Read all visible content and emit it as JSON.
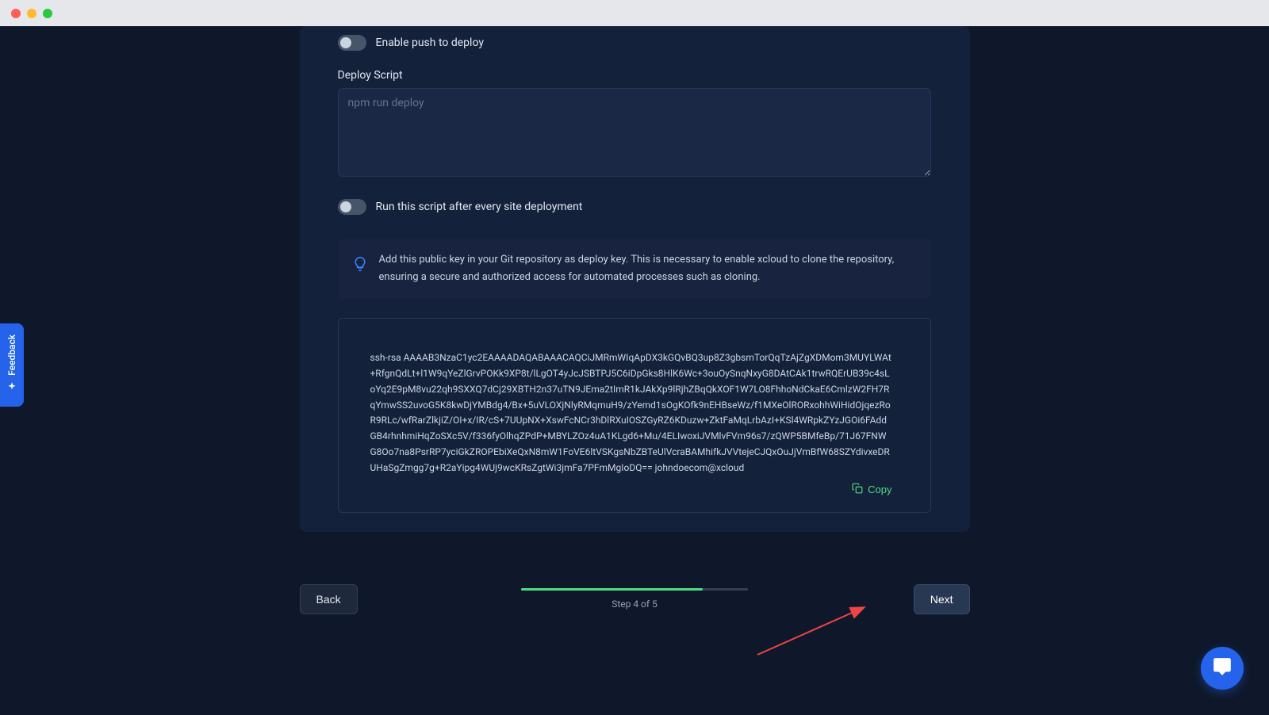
{
  "toggles": {
    "push_deploy": {
      "label": "Enable push to deploy",
      "enabled": false
    },
    "run_after": {
      "label": "Run this script after every site deployment",
      "enabled": false
    }
  },
  "deploy_script": {
    "label": "Deploy Script",
    "placeholder": "npm run deploy",
    "value": ""
  },
  "info": {
    "text": "Add this public key in your Git repository as deploy key. This is necessary to enable xcloud to clone the repository, ensuring a secure and authorized access for automated processes such as cloning."
  },
  "ssh_key": {
    "text": "ssh-rsa AAAAB3NzaC1yc2EAAAADAQABAAACAQCiJMRmWIqApDX3kGQvBQ3up8Z3gbsmTorQqTzAjZgXDMom3MUYLWAt+RfgnQdLt+l1W9qYeZlGrvPOKk9XP8t/lLgOT4yJcJSBTPJ5C6iDpGks8HlK6Wc+3ouOySnqNxyG8DAtCAk1trwRQErUB39c4sLoYq2E9pM8vu22qh9SXXQ7dCj29XBTH2n37uTN9JEma2tImR1kJAkXp9lRjhZBqQkXOF1W7LO8FhhoNdCkaE6CmlzW2FH7RqYmwSS2uvoG5K8kwDjYMBdg4/Bx+5uVLOXjNlyRMqmuH9/zYemd1sOgKOfk9nEHBseWz/f1MXeOlRORxohhWiHidOjqezRoR9RLc/wfRarZlkjiZ/OI+x/IR/cS+7UUpNX+XswFcNCr3hDlRXuIOSZGyRZ6KDuzw+ZktFaMqLrbAzI+KSl4WRpkZYzJGOi6FAddGB4rhnhmiHqZoSXc5V/f336fyOlhqZPdP+MBYLZOz4uA1KLgd6+Mu/4ELIwoxiJVMlvFVm96s7/zQWP5BMfeBp/71J67FNWG8Oo7na8PsrRP7yciGkZROPEbiXeQxN8mW1FoVE6ltVSKgsNbZBTeUlVcraBAMhifkJVVtejeCJQxOuJjVmBfW68SZYdivxeDRUHaSgZmgg7g+R2aYipg4WUj9wcKRsZgtWi3jmFa7PFmMgIoDQ== johndoecom@xcloud"
  },
  "copy": {
    "label": "Copy"
  },
  "footer": {
    "back_label": "Back",
    "next_label": "Next",
    "step_label": "Step 4 of 5",
    "progress_percent": 80
  },
  "feedback": {
    "label": "Feedback"
  }
}
